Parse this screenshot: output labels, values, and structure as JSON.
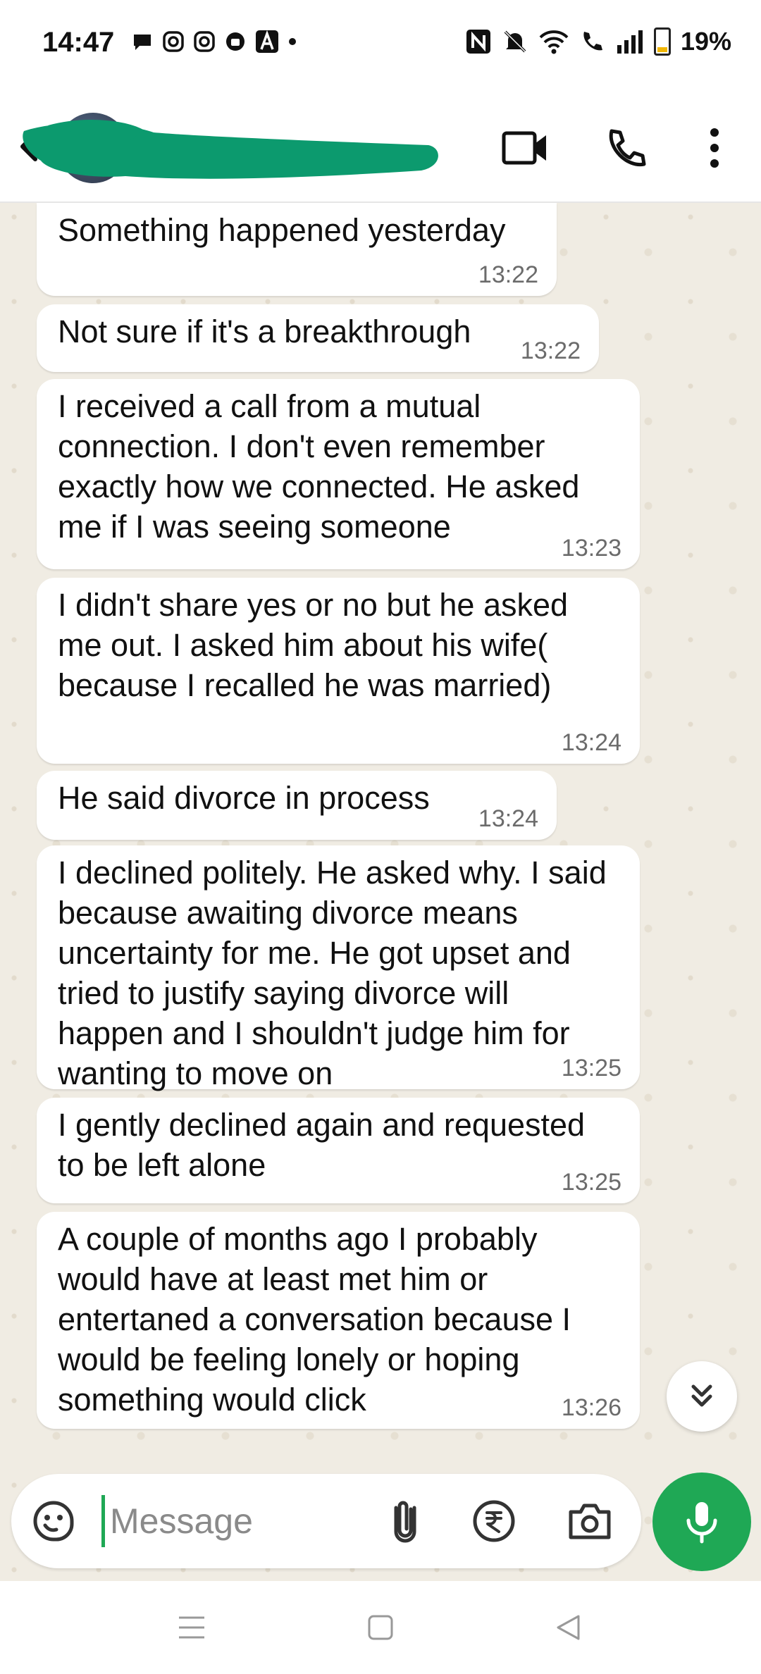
{
  "status_bar": {
    "time": "14:47",
    "battery": "19%",
    "battery_level": 0.19,
    "notification_icons": [
      "chat-bubble-icon",
      "instagram-icon",
      "instagram-icon",
      "cloud-icon",
      "a-logo-icon",
      "dot-icon"
    ],
    "system_icons": [
      "nfc-icon",
      "mute-bell-icon",
      "wifi-icon",
      "wifi-call-icon",
      "signal-icon",
      "battery-icon"
    ]
  },
  "header": {
    "icons": [
      "back-arrow-icon",
      "video-call-icon",
      "phone-icon",
      "more-vert-icon"
    ]
  },
  "messages": [
    {
      "text": "Something happened yesterday",
      "time": "13:22"
    },
    {
      "text": "Not sure if it's a breakthrough",
      "time": "13:22"
    },
    {
      "text": "I received a call from a mutual connection. I don't even remember exactly how we connected. He asked me if I was seeing someone",
      "time": "13:23"
    },
    {
      "text": "I didn't share yes or no but he asked me out. I asked him about his wife( because I recalled he was married)",
      "time": "13:24"
    },
    {
      "text": "He said divorce in process",
      "time": "13:24"
    },
    {
      "text": "I declined politely. He asked why. I said because awaiting divorce means uncertainty for me. He got upset and tried to justify saying divorce will happen and I shouldn't judge him for wanting to move on",
      "time": "13:25"
    },
    {
      "text": "I gently declined again and requested to be left alone",
      "time": "13:25"
    },
    {
      "text": "A couple of months ago I probably would have at least met him or entertaned a conversation because I would be feeling lonely or hoping something would click",
      "time": "13:26"
    }
  ],
  "input": {
    "placeholder": "Message",
    "value": ""
  },
  "colors": {
    "accent_green": "#1fa855",
    "redaction_green": "#0c9a6e",
    "bubble_white": "#ffffff",
    "chat_background": "#f0ece3"
  }
}
